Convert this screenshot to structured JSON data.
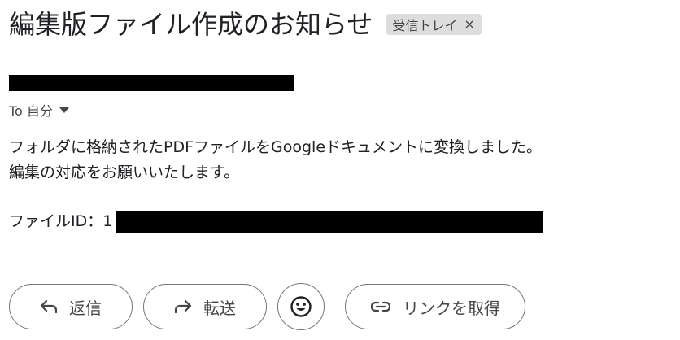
{
  "email": {
    "subject": "編集版ファイル作成のお知らせ",
    "label_chip": {
      "text": "受信トレイ",
      "close_glyph": "×"
    },
    "recipient": "To 自分",
    "body_lines": [
      "フォルダに格納されたPDFファイルをGoogleドキュメントに変換しました。",
      "編集の対応をお願いいたします。"
    ],
    "file_id_label": "ファイルID：1"
  },
  "actions": {
    "reply_label": "返信",
    "forward_label": "転送",
    "emoji_icon": "smiley-icon",
    "get_link_label": "リンクを取得"
  },
  "colors": {
    "text": "#202124",
    "secondary_text": "#444746",
    "chip_background": "#dddddd",
    "button_border": "#747775",
    "redaction": "#000000"
  }
}
